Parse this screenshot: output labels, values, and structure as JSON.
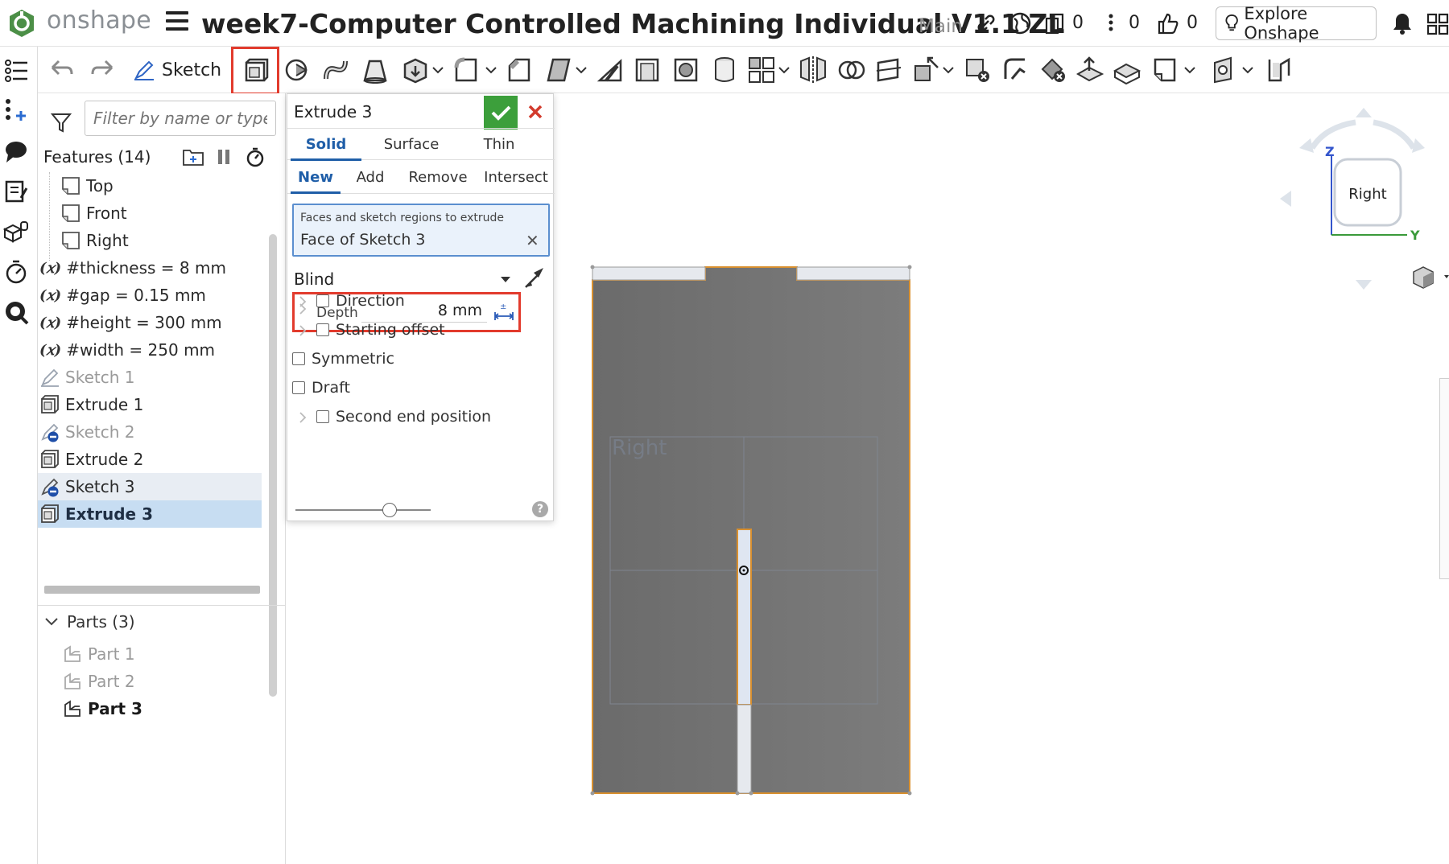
{
  "app": {
    "brand": "onshape",
    "document_title": "week7-Computer Controlled Machining Individual V1.1 ZL",
    "branch": "Main",
    "copies_count": "0",
    "comments_count": "0",
    "likes_count": "0",
    "explore_label": "Explore Onshape"
  },
  "toolbar": {
    "sketch_label": "Sketch"
  },
  "feature_panel": {
    "filter_placeholder": "Filter by name or type",
    "features_title": "Features (14)",
    "features": [
      {
        "label": "Top",
        "kind": "plane"
      },
      {
        "label": "Front",
        "kind": "plane"
      },
      {
        "label": "Right",
        "kind": "plane"
      },
      {
        "label": "#thickness = 8 mm",
        "kind": "variable"
      },
      {
        "label": "#gap = 0.15 mm",
        "kind": "variable"
      },
      {
        "label": "#height = 300 mm",
        "kind": "variable"
      },
      {
        "label": "#width = 250 mm",
        "kind": "variable"
      },
      {
        "label": "Sketch 1",
        "kind": "sketch"
      },
      {
        "label": "Extrude 1",
        "kind": "extrude"
      },
      {
        "label": "Sketch 2",
        "kind": "sketch"
      },
      {
        "label": "Extrude 2",
        "kind": "extrude"
      },
      {
        "label": "Sketch 3",
        "kind": "sketch"
      },
      {
        "label": "Extrude 3",
        "kind": "extrude"
      }
    ],
    "parts_title": "Parts (3)",
    "parts": [
      "Part 1",
      "Part 2",
      "Part 3"
    ]
  },
  "dialog": {
    "title": "Extrude 3",
    "body_tabs": [
      "Solid",
      "Surface",
      "Thin"
    ],
    "op_tabs": [
      "New",
      "Add",
      "Remove",
      "Intersect"
    ],
    "selection_label": "Faces and sketch regions to extrude",
    "selection_value": "Face of Sketch 3",
    "end_type": "Blind",
    "depth_label": "Depth",
    "depth_value": "8 mm",
    "direction_label": "Direction",
    "starting_offset_label": "Starting offset",
    "symmetric_label": "Symmetric",
    "draft_label": "Draft",
    "second_end_label": "Second end position",
    "help": "?"
  },
  "viewport": {
    "plane_label": "Right",
    "view_cube": {
      "face": "Right",
      "axis_z": "Z",
      "axis_y": "Y"
    }
  },
  "colors": {
    "accent_blue": "#1f5ea8",
    "highlight_red": "#e23b2d",
    "ok_green": "#3c9f3b",
    "selected_row": "#c7ddf2",
    "part_gray": "#6f6f6f",
    "edge_orange": "#d9902f"
  }
}
